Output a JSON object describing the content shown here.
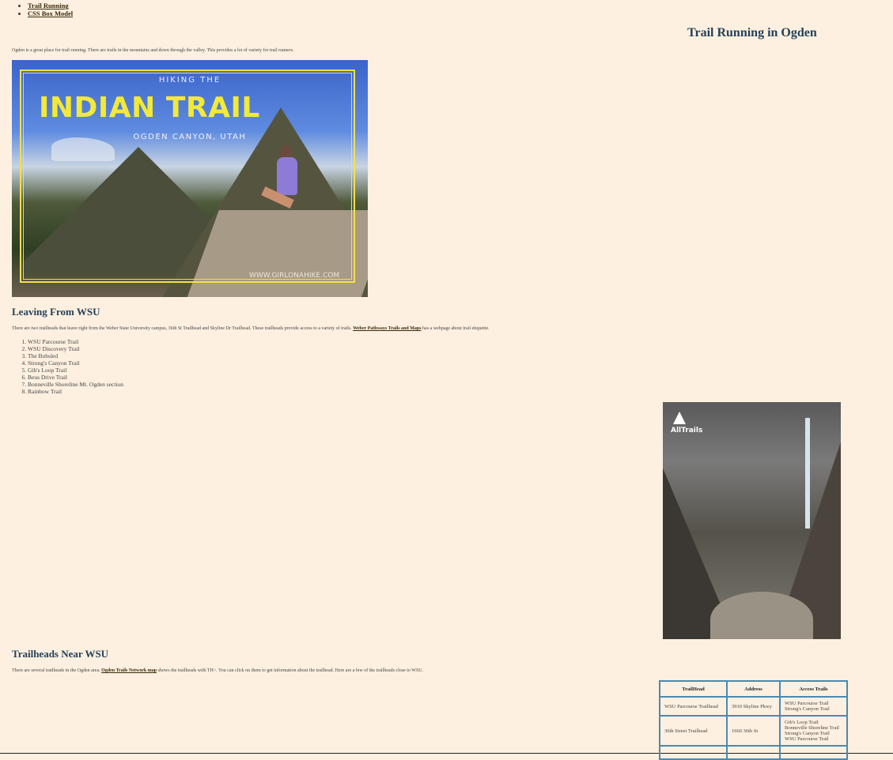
{
  "nav": {
    "items": [
      "Trail Running",
      "CSS Box Model"
    ]
  },
  "page": {
    "title": "Trail Running in Ogden",
    "intro": "Ogden is a great place for trail running. There are trails in the mountains and down through the valley. This provides a lot of variety for trail runners."
  },
  "hero_image": {
    "line1": "HIKING THE",
    "line2": "INDIAN TRAIL",
    "line3": "OGDEN CANYON, UTAH",
    "watermark": "WWW.GIRLONAHIKE.COM"
  },
  "leaving": {
    "heading": "Leaving From WSU",
    "text_before": "There are two trailheads that leave right from the Weber State University campus, 36th St Trailhead and Skyline Dr Trailhead. These trailheads provide access to a variety of trails. ",
    "link": "Weber Pathways Trails and Maps",
    "text_after": " has a webpage about trail etiquette.",
    "trails": [
      "WSU Parcourse Trail",
      "WSU Discovery Trail",
      "The Bobsled",
      "Strong's Canyon Trail",
      "Gib's Loop Trail",
      "Beus Drive Trail",
      "Bonneville Shoreline Mt. Ogden section",
      "Rainbow Trail"
    ]
  },
  "waterfall_image": {
    "logo": "AllTrails"
  },
  "trailheads": {
    "heading": "Trailheads Near WSU",
    "text_before": "There are several trailheads in the Ogden area. ",
    "link": "Ogden Trails Network map",
    "text_after": " shows the trailheads with TH>. You can click on them to get information about the trailhead. Here are a few of the trailheads close to WSU.",
    "table": {
      "headers": [
        "TrailHead",
        "Address",
        "Access Trails"
      ],
      "rows": [
        {
          "name": "WSU Parcourse Trailhead",
          "address": "3910 Skyline Pkwy",
          "trails": [
            "WSU Parcourse Trail",
            "Strong's Canyon Trail"
          ]
        },
        {
          "name": "36th Street Trailhead",
          "address": "1660 36th St",
          "trails": [
            "Gib's Loop Trail",
            "Bonneville Shoreline Trail",
            "Strong's Canyon Trail",
            "WSU Parcourse Trail"
          ]
        }
      ]
    }
  }
}
